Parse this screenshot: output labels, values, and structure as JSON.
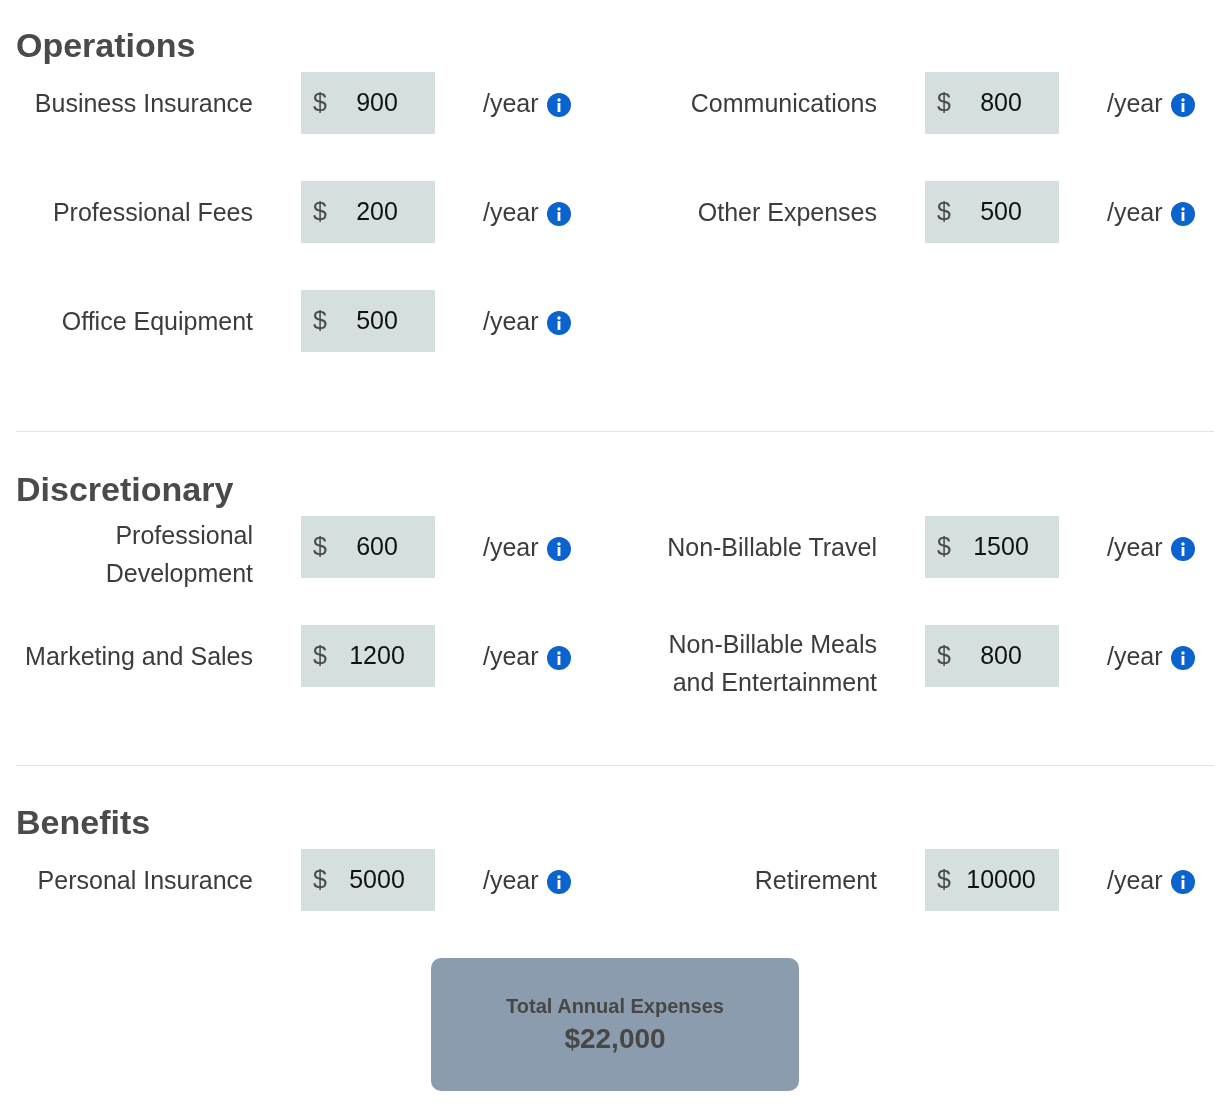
{
  "sections": [
    {
      "title": "Operations",
      "fields": [
        {
          "label": "Business Insurance",
          "currency": "$",
          "value": "900",
          "unit": "/year"
        },
        {
          "label": "Communications",
          "currency": "$",
          "value": "800",
          "unit": "/year"
        },
        {
          "label": "Professional Fees",
          "currency": "$",
          "value": "200",
          "unit": "/year"
        },
        {
          "label": "Other Expenses",
          "currency": "$",
          "value": "500",
          "unit": "/year"
        },
        {
          "label": "Office Equipment",
          "currency": "$",
          "value": "500",
          "unit": "/year"
        }
      ]
    },
    {
      "title": "Discretionary",
      "fields": [
        {
          "label": "Professional Development",
          "currency": "$",
          "value": "600",
          "unit": "/year"
        },
        {
          "label": "Non-Billable Travel",
          "currency": "$",
          "value": "1500",
          "unit": "/year"
        },
        {
          "label": "Marketing and Sales",
          "currency": "$",
          "value": "1200",
          "unit": "/year"
        },
        {
          "label": "Non-Billable Meals and Entertainment",
          "currency": "$",
          "value": "800",
          "unit": "/year"
        }
      ]
    },
    {
      "title": "Benefits",
      "fields": [
        {
          "label": "Personal Insurance",
          "currency": "$",
          "value": "5000",
          "unit": "/year"
        },
        {
          "label": "Retirement",
          "currency": "$",
          "value": "10000",
          "unit": "/year"
        }
      ]
    }
  ],
  "total": {
    "label": "Total Annual Expenses",
    "value": "$22,000"
  }
}
